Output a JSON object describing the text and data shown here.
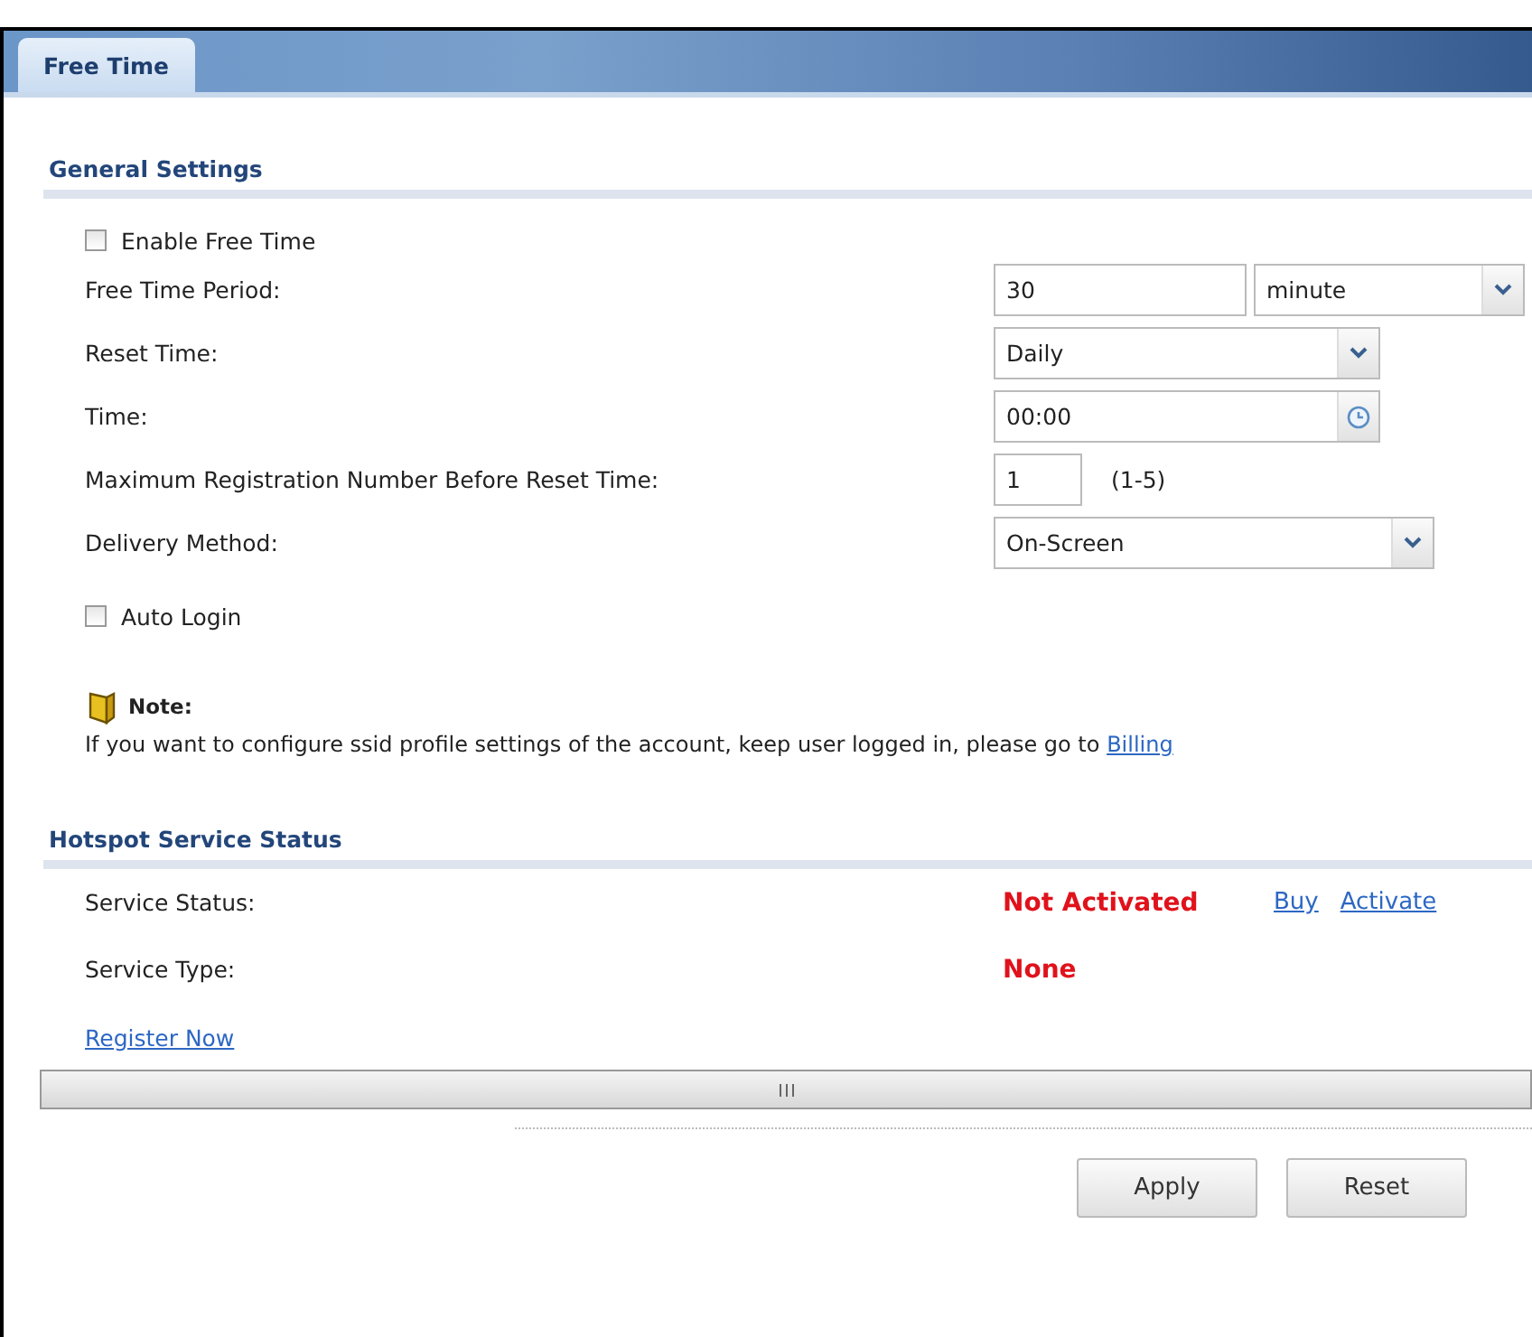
{
  "tabs": [
    {
      "label": "Free Time",
      "selected": true
    }
  ],
  "general": {
    "title": "General Settings",
    "enable": {
      "label": "Enable Free Time",
      "checked": false
    },
    "fields": [
      {
        "kind": "input-select",
        "label": "Free Time Period:",
        "value": "30",
        "select": "minute"
      },
      {
        "kind": "select",
        "label": "Reset Time:",
        "value": "Daily"
      },
      {
        "kind": "time",
        "label": "Time:",
        "value": "00:00"
      },
      {
        "kind": "number",
        "label": "Maximum Registration Number Before Reset Time:",
        "value": "1",
        "hint": "(1-5)"
      },
      {
        "kind": "select",
        "label": "Delivery Method:",
        "value": "On-Screen"
      }
    ],
    "auto_login": {
      "label": "Auto Login",
      "checked": false
    },
    "note": {
      "title": "Note:",
      "text": "If you want to configure ssid profile settings of the account, keep user logged in, please go to",
      "link": "Billing"
    }
  },
  "hotspot": {
    "title": "Hotspot Service Status",
    "rows": [
      {
        "label": "Service Status:",
        "value": "Not Activated",
        "links": [
          "Buy",
          "Activate"
        ]
      },
      {
        "label": "Service Type:",
        "value": "None",
        "links": []
      }
    ],
    "register_link": "Register Now"
  },
  "buttons": [
    "Apply",
    "Reset"
  ]
}
